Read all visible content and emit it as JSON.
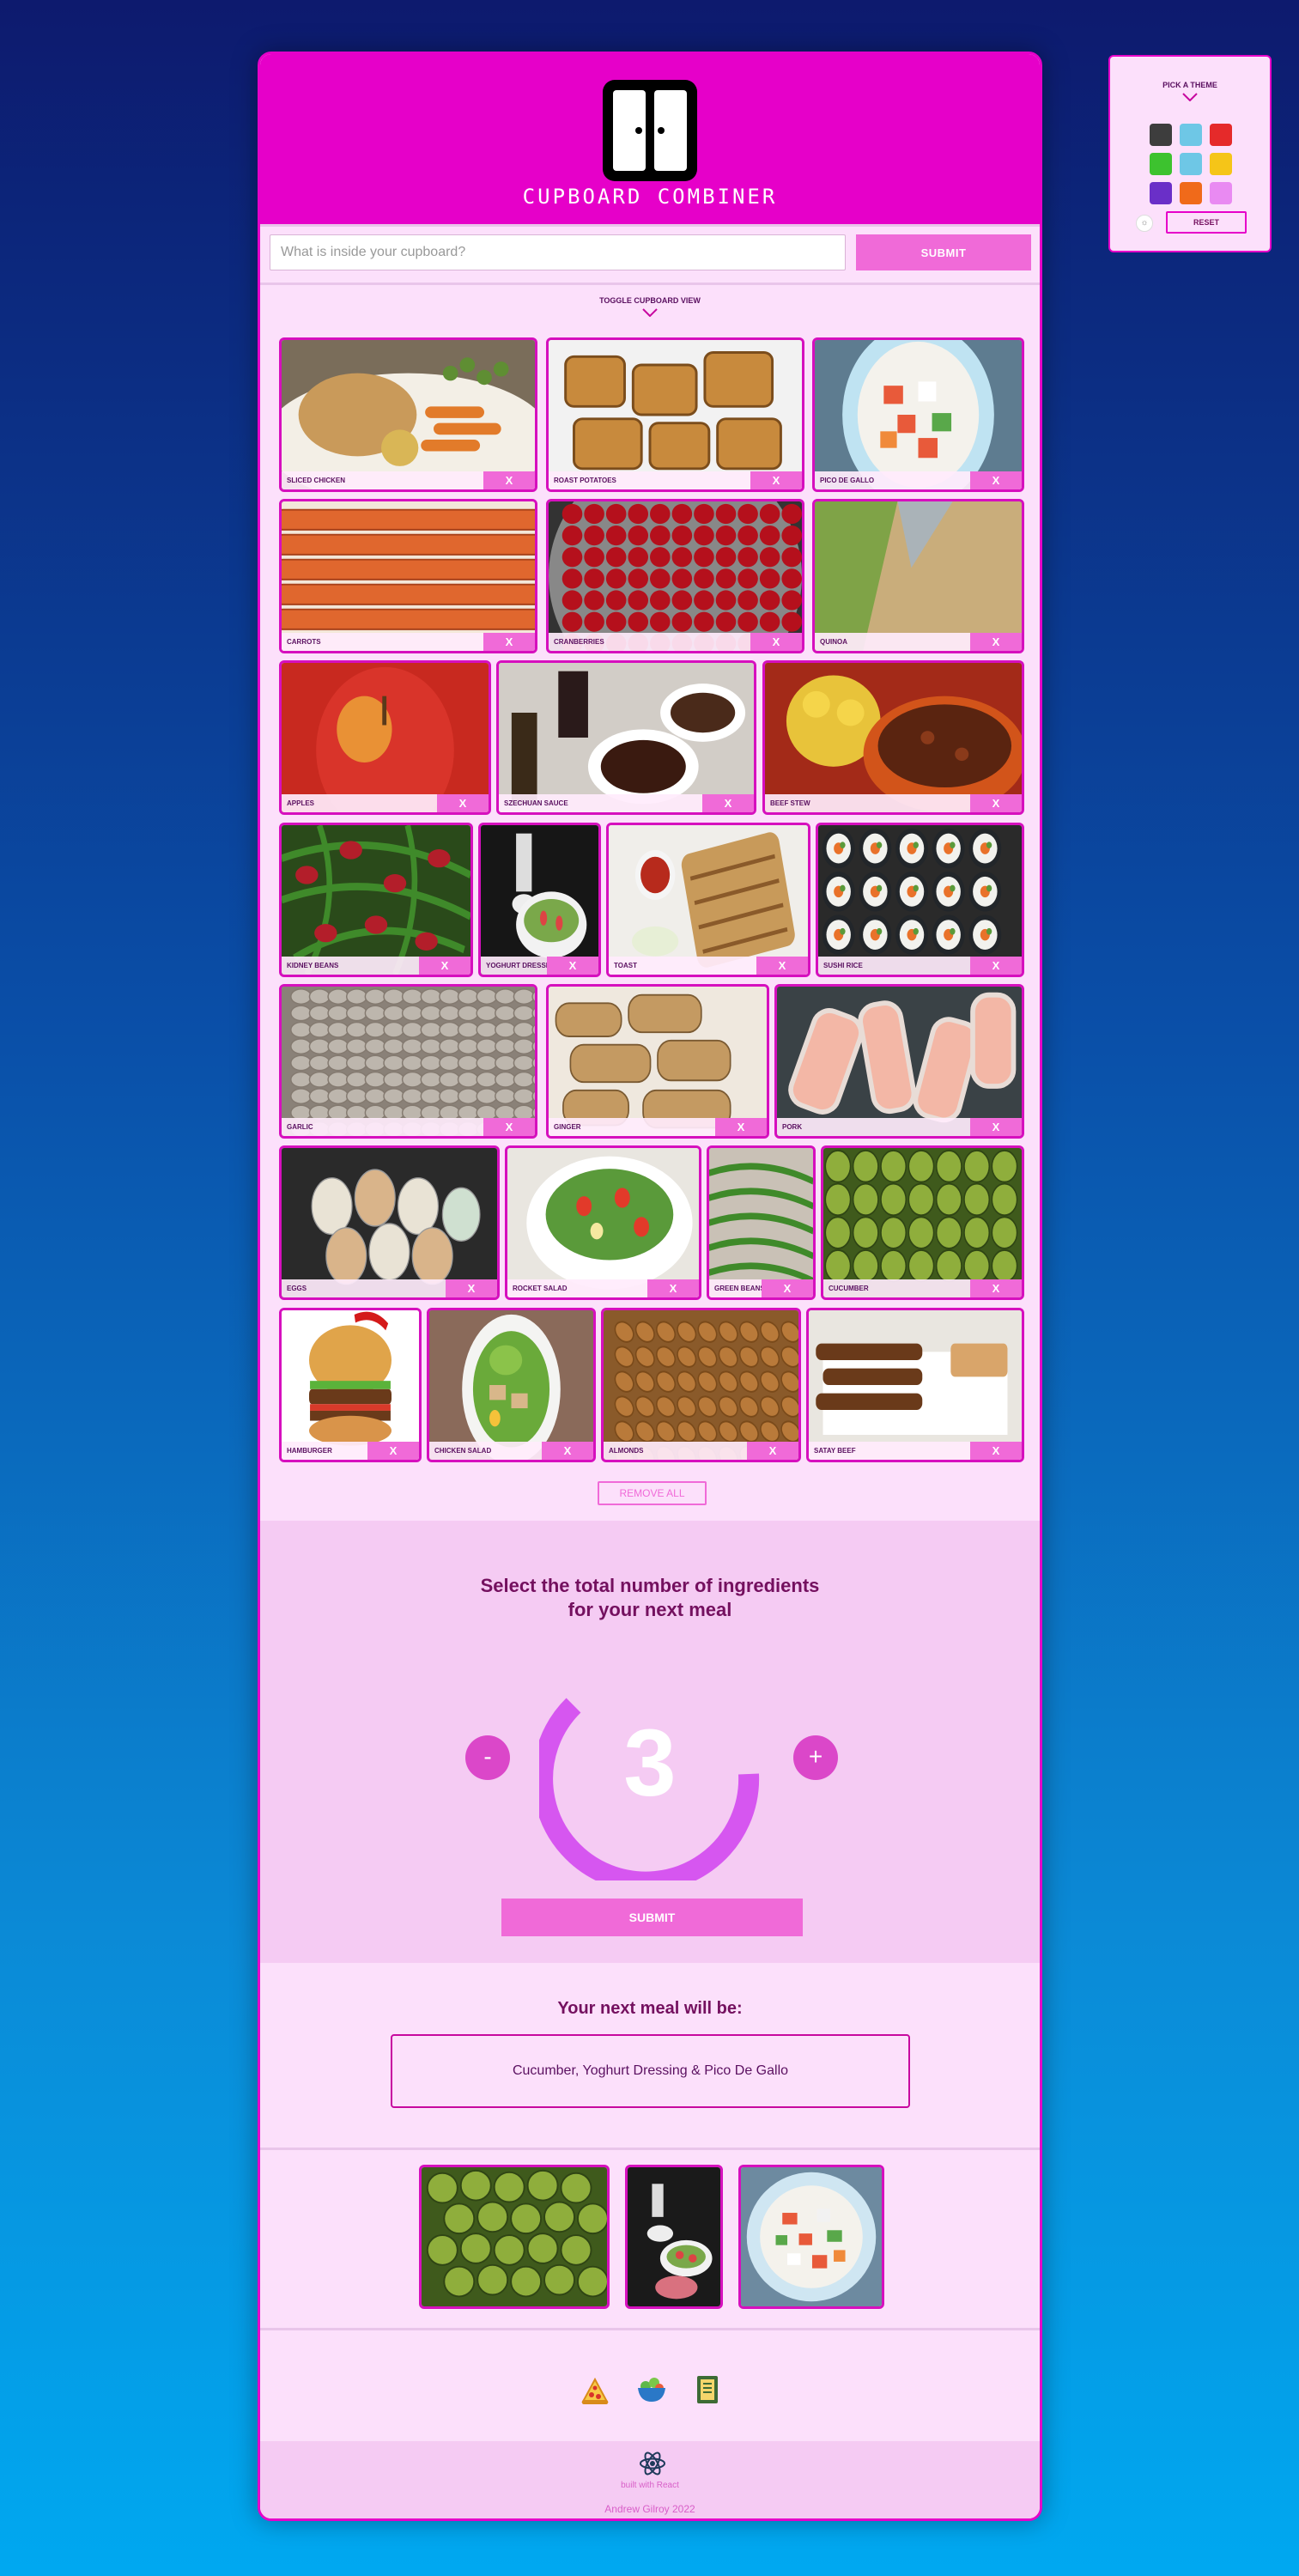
{
  "app": {
    "title": "CUPBOARD COMBINER"
  },
  "search": {
    "placeholder": "What is inside your cupboard?",
    "submit_label": "SUBMIT"
  },
  "toggle_label": "TOGGLE CUPBOARD VIEW",
  "cards": [
    {
      "label": "SLICED CHICKEN",
      "x": "X"
    },
    {
      "label": "ROAST POTATOES",
      "x": "X"
    },
    {
      "label": "PICO DE GALLO",
      "x": "X"
    },
    {
      "label": "CARROTS",
      "x": "X"
    },
    {
      "label": "CRANBERRIES",
      "x": "X"
    },
    {
      "label": "QUINOA",
      "x": "X"
    },
    {
      "label": "APPLES",
      "x": "X"
    },
    {
      "label": "SZECHUAN SAUCE",
      "x": "X"
    },
    {
      "label": "BEEF STEW",
      "x": "X"
    },
    {
      "label": "KIDNEY BEANS",
      "x": "X"
    },
    {
      "label": "YOGHURT DRESSING",
      "x": "X"
    },
    {
      "label": "TOAST",
      "x": "X"
    },
    {
      "label": "SUSHI RICE",
      "x": "X"
    },
    {
      "label": "GARLIC",
      "x": "X"
    },
    {
      "label": "GINGER",
      "x": "X"
    },
    {
      "label": "PORK",
      "x": "X"
    },
    {
      "label": "EGGS",
      "x": "X"
    },
    {
      "label": "ROCKET SALAD",
      "x": "X"
    },
    {
      "label": "GREEN BEANS",
      "x": "X"
    },
    {
      "label": "CUCUMBER",
      "x": "X"
    },
    {
      "label": "HAMBURGER",
      "x": "X"
    },
    {
      "label": "CHICKEN SALAD",
      "x": "X"
    },
    {
      "label": "ALMONDS",
      "x": "X"
    },
    {
      "label": "SATAY BEEF",
      "x": "X"
    }
  ],
  "remove_all_label": "REMOVE ALL",
  "selector": {
    "title_line1": "Select the total number of ingredients",
    "title_line2": "for your next meal",
    "minus": "-",
    "plus": "+",
    "count": "3",
    "submit_label": "SUBMIT"
  },
  "meal": {
    "title": "Your next meal will be:",
    "result": "Cucumber, Yoghurt Dressing & Pico De Gallo"
  },
  "icons": [
    "pizza-icon",
    "salad-bowl-icon",
    "recipe-book-icon"
  ],
  "footer": {
    "built_with": "built with React",
    "author": "Andrew Gilroy 2022"
  },
  "theme_picker": {
    "title": "PICK A THEME",
    "reset_label": "RESET",
    "swatches": [
      "#3d3d3d",
      "#6ec7e6",
      "#e52a2a",
      "#3dc22f",
      "#6ec7e6",
      "#f5c518",
      "#6a2fc8",
      "#f06a1a",
      "#e98af2"
    ]
  }
}
